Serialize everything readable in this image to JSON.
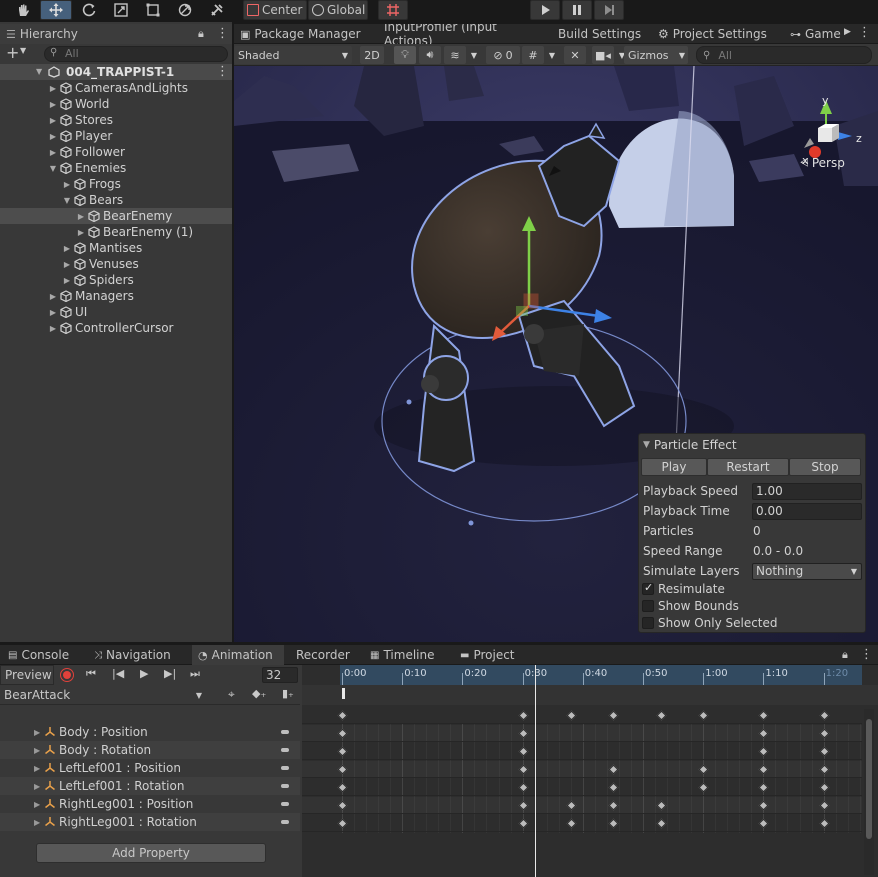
{
  "toolbar": {
    "pivot_label": "Center",
    "space_label": "Global"
  },
  "hierarchy": {
    "tab_label": "Hierarchy",
    "search_placeholder": "All",
    "scene_name": "004_TRAPPIST-1",
    "items": [
      {
        "label": "CamerasAndLights",
        "depth": 1,
        "expanded": false
      },
      {
        "label": "World",
        "depth": 1,
        "expanded": false
      },
      {
        "label": "Stores",
        "depth": 1,
        "expanded": false
      },
      {
        "label": "Player",
        "depth": 1,
        "expanded": false
      },
      {
        "label": "Follower",
        "depth": 1,
        "expanded": false
      },
      {
        "label": "Enemies",
        "depth": 1,
        "expanded": true
      },
      {
        "label": "Frogs",
        "depth": 2,
        "expanded": false
      },
      {
        "label": "Bears",
        "depth": 2,
        "expanded": true
      },
      {
        "label": "BearEnemy",
        "depth": 3,
        "expanded": false,
        "selected": true
      },
      {
        "label": "BearEnemy (1)",
        "depth": 3,
        "expanded": false
      },
      {
        "label": "Mantises",
        "depth": 2,
        "expanded": false
      },
      {
        "label": "Venuses",
        "depth": 2,
        "expanded": false
      },
      {
        "label": "Spiders",
        "depth": 2,
        "expanded": false
      },
      {
        "label": "Managers",
        "depth": 1,
        "expanded": false
      },
      {
        "label": "UI",
        "depth": 1,
        "expanded": false
      },
      {
        "label": "ControllerCursor",
        "depth": 1,
        "expanded": false
      }
    ]
  },
  "scene_tabs": [
    {
      "label": "Package Manager"
    },
    {
      "label": "InputProfiler (Input Actions)"
    },
    {
      "label": "Build Settings"
    },
    {
      "label": "Project Settings"
    },
    {
      "label": "Game"
    }
  ],
  "scene_toolbar": {
    "draw_mode": "Shaded",
    "mode_2d": "2D",
    "hidden_count": "0",
    "gizmos_label": "Gizmos",
    "search_placeholder": "All"
  },
  "gizmo": {
    "y": "y",
    "z": "z",
    "x": "x",
    "projection": "Persp"
  },
  "particle_effect": {
    "title": "Particle Effect",
    "buttons": {
      "play": "Play",
      "restart": "Restart",
      "stop": "Stop"
    },
    "fields": [
      {
        "label": "Playback Speed",
        "value": "1.00",
        "kind": "input"
      },
      {
        "label": "Playback Time",
        "value": "0.00",
        "kind": "input"
      },
      {
        "label": "Particles",
        "value": "0",
        "kind": "text"
      },
      {
        "label": "Speed Range",
        "value": "0.0 - 0.0",
        "kind": "text"
      },
      {
        "label": "Simulate Layers",
        "value": "Nothing",
        "kind": "dropdown"
      }
    ],
    "checkboxes": [
      {
        "label": "Resimulate",
        "checked": true
      },
      {
        "label": "Show Bounds",
        "checked": false
      },
      {
        "label": "Show Only Selected",
        "checked": false
      }
    ]
  },
  "bottom_tabs": [
    {
      "label": "Console"
    },
    {
      "label": "Navigation"
    },
    {
      "label": "Animation",
      "active": true
    },
    {
      "label": "Recorder"
    },
    {
      "label": "Timeline"
    },
    {
      "label": "Project"
    }
  ],
  "animation": {
    "preview_label": "Preview",
    "frame": "32",
    "clip_name": "BearAttack",
    "add_property_label": "Add Property",
    "time_labels": [
      "0:00",
      "0:10",
      "0:20",
      "0:30",
      "0:40",
      "0:50",
      "1:00",
      "1:10",
      "1:20"
    ],
    "playhead_frame": 32,
    "properties": [
      {
        "label": "Body : Position",
        "keys": [
          0,
          30,
          70,
          80
        ]
      },
      {
        "label": "Body : Rotation",
        "keys": [
          0,
          30,
          70,
          80
        ]
      },
      {
        "label": "LeftLef001 : Position",
        "keys": [
          0,
          30,
          45,
          60,
          70,
          80
        ]
      },
      {
        "label": "LeftLef001 : Rotation",
        "keys": [
          0,
          30,
          45,
          60,
          70,
          80
        ]
      },
      {
        "label": "RightLeg001 : Position",
        "keys": [
          0,
          30,
          38,
          45,
          53,
          70,
          80
        ]
      },
      {
        "label": "RightLeg001 : Rotation",
        "keys": [
          0,
          30,
          38,
          45,
          53,
          70,
          80
        ]
      }
    ],
    "summary_keys": [
      0,
      30,
      38,
      45,
      53,
      60,
      70,
      80
    ]
  },
  "colors": {
    "accent_blue": "#46607c",
    "selection": "#4d4d4d",
    "record_red": "#e0413b",
    "panel": "#383838"
  }
}
